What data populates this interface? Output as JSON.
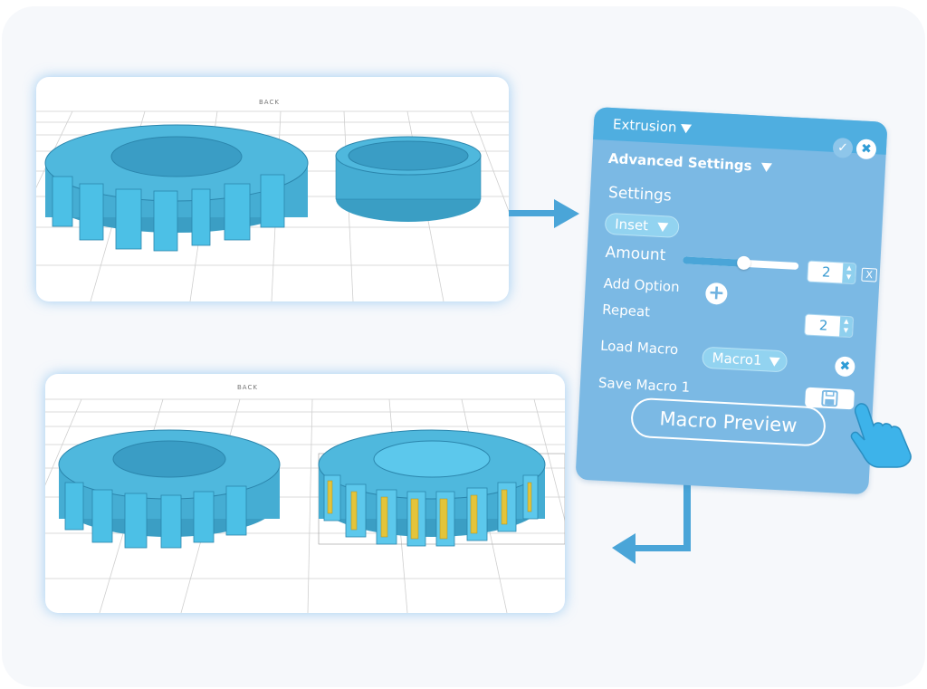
{
  "viewports": {
    "top": {
      "view_label": "BACK",
      "description": "Gear with extruded teeth next to ring"
    },
    "bottom": {
      "view_label": "BACK",
      "description": "Two gears, right gear with inset faces highlighted"
    }
  },
  "panel": {
    "title": "Extrusion",
    "confirm_icon": "check-icon",
    "close_icon": "close-icon",
    "advanced_settings_label": "Advanced Settings",
    "settings_label": "Settings",
    "settings_select": {
      "value": "Inset"
    },
    "amount": {
      "label": "Amount",
      "slider_fraction": 0.52,
      "value": "2",
      "reset_label": "X"
    },
    "add_option_label": "Add Option",
    "add_option_icon": "+",
    "repeat": {
      "label": "Repeat",
      "value": "2"
    },
    "load_macro": {
      "label": "Load Macro",
      "value": "Macro1",
      "clear_icon": "✖"
    },
    "save_macro": {
      "label": "Save Macro 1",
      "icon": "floppy-disk-icon"
    },
    "macro_preview_label": "Macro Preview",
    "stepper_up": "▲",
    "stepper_down": "▼"
  },
  "colors": {
    "panel_bg": "#7bb9e4",
    "panel_header": "#4faee0",
    "accent": "#4aa5d8",
    "model": "#4ab8dc",
    "highlight": "#e3c43a"
  }
}
